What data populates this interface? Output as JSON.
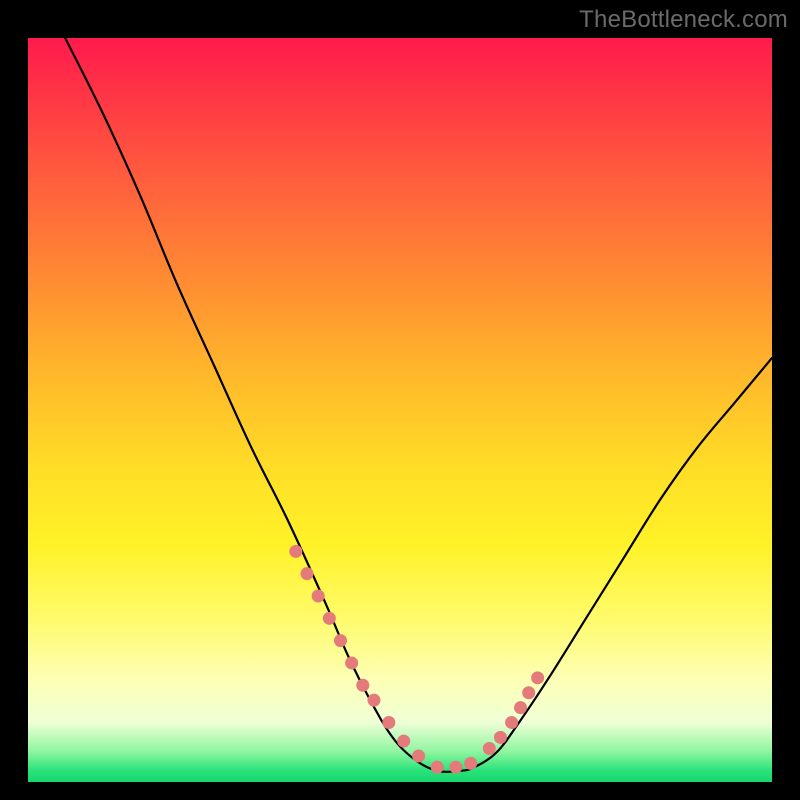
{
  "watermark": "TheBottleneck.com",
  "colors": {
    "background": "#000000",
    "curve": "#000000",
    "marker": "#e47a7a",
    "gradient_top": "#ff1a4d",
    "gradient_bottom": "#17d66e"
  },
  "chart_data": {
    "type": "line",
    "title": "",
    "xlabel": "",
    "ylabel": "",
    "xlim": [
      0,
      100
    ],
    "ylim": [
      0,
      100
    ],
    "series": [
      {
        "name": "bottleneck-curve",
        "x": [
          5,
          10,
          15,
          20,
          25,
          30,
          35,
          40,
          43,
          46,
          49,
          52,
          55,
          58,
          60,
          63,
          66,
          70,
          75,
          80,
          85,
          90,
          95,
          100
        ],
        "y": [
          100,
          90,
          79,
          67,
          56,
          45,
          35,
          24,
          17,
          11,
          6,
          3,
          1.5,
          1.5,
          2,
          4,
          8,
          14,
          22,
          30,
          38,
          45,
          51,
          57
        ]
      }
    ],
    "markers": {
      "name": "highlight-points",
      "x": [
        36,
        37.5,
        39,
        40.5,
        42,
        43.5,
        45,
        46.5,
        48.5,
        50.5,
        52.5,
        55,
        57.5,
        59.5,
        62,
        63.5,
        65,
        66.2,
        67.3,
        68.5
      ],
      "y": [
        31,
        28,
        25,
        22,
        19,
        16,
        13,
        11,
        8,
        5.5,
        3.5,
        2,
        2,
        2.5,
        4.5,
        6,
        8,
        10,
        12,
        14
      ]
    }
  }
}
